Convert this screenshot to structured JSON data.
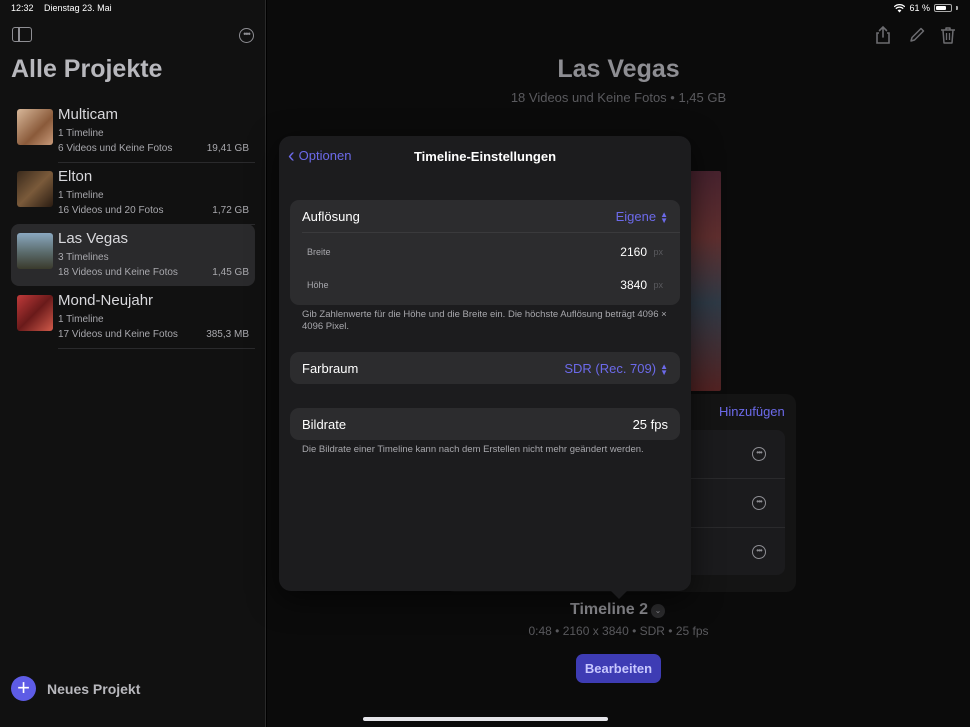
{
  "status": {
    "time": "12:32",
    "date": "Dienstag 23. Mai",
    "battery": "61 %",
    "icons": [
      "wifi-icon",
      "battery-icon"
    ]
  },
  "sidebar": {
    "title": "Alle Projekte",
    "projects": [
      {
        "name": "Multicam",
        "timelines": "1 Timeline",
        "media": "6 Videos und Keine Fotos",
        "size": "19,41 GB",
        "selected": false,
        "thumb_color": "#b07a5a"
      },
      {
        "name": "Elton",
        "timelines": "1 Timeline",
        "media": "16 Videos und 20 Fotos",
        "size": "1,72 GB",
        "selected": false,
        "thumb_color": "#4a3a2c"
      },
      {
        "name": "Las Vegas",
        "timelines": "3 Timelines",
        "media": "18 Videos und Keine Fotos",
        "size": "1,45 GB",
        "selected": true,
        "thumb_color": "#5a7a8c"
      },
      {
        "name": "Mond-Neujahr",
        "timelines": "1 Timeline",
        "media": "17 Videos und Keine Fotos",
        "size": "385,3 MB",
        "selected": false,
        "thumb_color": "#8a2a2a"
      }
    ],
    "new_project_label": "Neues Projekt"
  },
  "main": {
    "title": "Las Vegas",
    "subtitle": "18 Videos und Keine Fotos • 1,45 GB",
    "add_label": "Hinzufügen",
    "timeline_name": "Timeline 2",
    "timeline_meta": "0:48 • 2160 x 3840 • SDR • 25 fps",
    "edit_label": "Bearbeiten"
  },
  "popover": {
    "back_label": "Optionen",
    "title": "Timeline-Einstellungen",
    "resolution_label": "Auflösung",
    "resolution_value": "Eigene",
    "width_label": "Breite",
    "width_value": "2160",
    "height_label": "Höhe",
    "height_value": "3840",
    "unit": "px",
    "resolution_note": "Gib Zahlenwerte für die Höhe und die Breite ein. Die höchste Auflösung beträgt 4096 × 4096 Pixel.",
    "colorspace_label": "Farbraum",
    "colorspace_value": "SDR (Rec. 709)",
    "framerate_label": "Bildrate",
    "framerate_value": "25 fps",
    "framerate_note": "Die Bildrate einer Timeline kann nach dem Erstellen nicht mehr geändert werden."
  },
  "colors": {
    "accent": "#6c6aea",
    "button": "#3e3cb4"
  }
}
